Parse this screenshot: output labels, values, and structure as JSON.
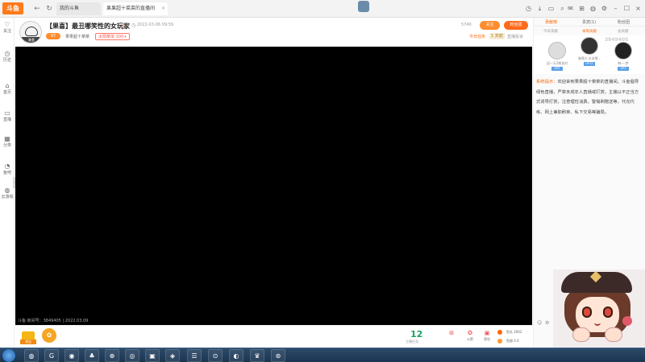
{
  "browser": {
    "logo": "斗鱼",
    "tabs": [
      {
        "label": "我的斗鱼",
        "active": false
      },
      {
        "label": "果果超十菜菜的直播间",
        "active": true
      }
    ]
  },
  "sidebar": {
    "items": [
      {
        "icon": "♡",
        "label": "关注"
      },
      {
        "icon": "◷",
        "label": "历史"
      },
      {
        "icon": "⌂",
        "label": "首页"
      },
      {
        "icon": "▭",
        "label": "直播"
      },
      {
        "icon": "▦",
        "label": "分类"
      },
      {
        "icon": "◔",
        "label": "鱼吧"
      },
      {
        "icon": "◍",
        "label": "云游戏"
      }
    ]
  },
  "header": {
    "avatar_badge": "美食",
    "title": "【果喜】最丑哪笑性的女玩家",
    "hot_count": "3",
    "date": "2022-03-06 09:59",
    "level_badge": "97",
    "streamer_name": "果果超十菜菜",
    "rank_tag": "太阳菜单 300+",
    "viewers": "5740",
    "follow_label": "关注",
    "fans_label": "粉丝团",
    "task_tag": "今日任务",
    "task_time": "1 天前",
    "report": "直播投诉"
  },
  "video": {
    "room_info": "斗鱼 房间号：3849405 | 2022.03.09"
  },
  "bottombar": {
    "gift_label": "领宝",
    "level_num": "12",
    "level_label": "主播任务",
    "tools": [
      {
        "icon": "⊞",
        "label": ""
      },
      {
        "icon": "✪",
        "label": "火箭"
      },
      {
        "icon": "▣",
        "label": "背包"
      }
    ],
    "yuwan": "鱼丸 2602",
    "yuchi": "鱼翅 4.4"
  },
  "rightpanel": {
    "tabs": [
      {
        "label": "贡献榜",
        "active": true
      },
      {
        "label": "贵宾(1)",
        "active": false
      },
      {
        "label": "粉丝团",
        "active": false
      }
    ],
    "subtabs": [
      {
        "label": "今日贡献",
        "active": false
      },
      {
        "label": "本周贡献",
        "active": true
      },
      {
        "label": "总贡献",
        "active": false
      }
    ],
    "room_overlay": "3849405",
    "ranks": [
      {
        "name": "迎一天2期说对",
        "lv": "UP5"
      },
      {
        "name": "海绵大·水米果...",
        "lv": "UP12"
      },
      {
        "name": "韩一·梦",
        "lv": "UP3"
      }
    ],
    "notice_tag": "系统提示：",
    "notice_text": "欢迎来到果果超十菜菜的直播间。斗鱼倡导绿色直播，严禁未成年人直播或打赏，主播以不正当方式诱导打赏，注意理性消费。警惕刷赠送等，代充代练、网上兼职刷单、私下交易等骗局。"
  },
  "taskbar": {
    "apps": [
      "◍",
      "G",
      "◉",
      "♣",
      "⊕",
      "◎",
      "▣",
      "◈",
      "☰",
      "⊙",
      "◐",
      "♛",
      "⊛"
    ]
  }
}
